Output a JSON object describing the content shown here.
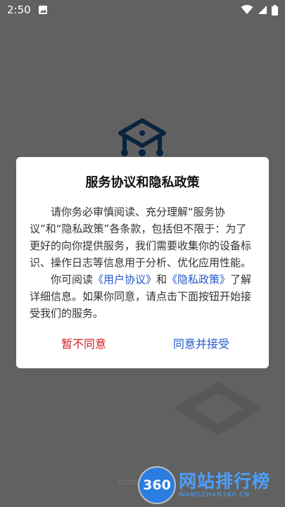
{
  "status_bar": {
    "time": "2:50"
  },
  "dialog": {
    "title": "服务协议和隐私政策",
    "para1": "请你务必审慎阅读、充分理解“服务协议”和“隐私政策”各条款，包括但不限于：为了更好的向你提供服务，我们需要收集你的设备标识、操作日志等信息用于分析、优化应用性能。",
    "para2_prefix": "你可阅读",
    "user_agreement_link": "《用户协议》",
    "para2_and": "和",
    "privacy_policy_link": "《隐私政策》",
    "para2_suffix": "了解详细信息。如果你同意，请点击下面按钮开始接受我们的服务。",
    "decline_label": "暂不同意",
    "accept_label": "同意并接受"
  },
  "footer": {
    "copyright": "©2022 深圳市计"
  },
  "watermark": {
    "badge": "360",
    "title": "网站排行榜",
    "subtitle": "WANGZHAN360.CN"
  },
  "colors": {
    "link": "#2358c9",
    "decline": "#d42020",
    "logo": "#1f5fa0",
    "watermark": "#4ba0ff"
  }
}
